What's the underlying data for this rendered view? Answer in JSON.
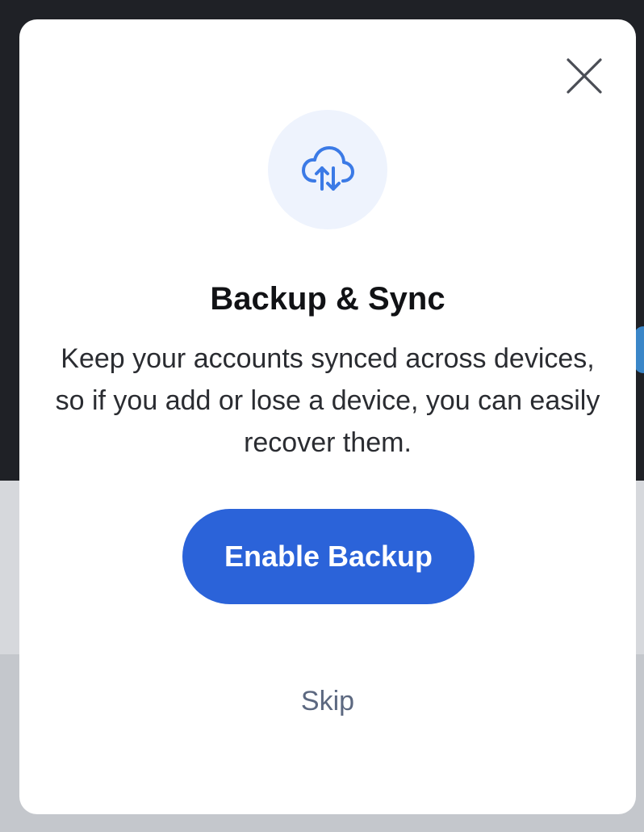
{
  "modal": {
    "title": "Backup & Sync",
    "description": "Keep your accounts synced across devices, so if you add or lose a device, you can easily recover them.",
    "primary_button_label": "Enable Backup",
    "secondary_link_label": "Skip",
    "close_icon": "close-icon",
    "feature_icon": "cloud-sync-icon"
  },
  "colors": {
    "accent": "#2b63d9",
    "icon_circle_bg": "#eef3fd",
    "icon_stroke": "#3b7ae6",
    "skip_text": "#5c6880",
    "backdrop_dark": "#1f2126",
    "backdrop_light": "#d6d8dc"
  }
}
